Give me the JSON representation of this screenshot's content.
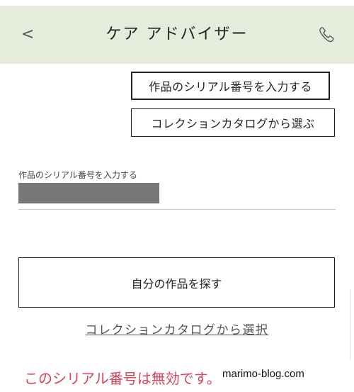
{
  "header": {
    "title": "ケア アドバイザー",
    "back_icon": "chevron-left-icon",
    "back_glyph": "<",
    "phone_icon": "phone-icon",
    "background": "#e6ecdb"
  },
  "options": {
    "serial_label": "作品のシリアル番号を入力する",
    "catalog_label": "コレクションカタログから選ぶ"
  },
  "serial_field": {
    "label": "作品のシリアル番号を入力する",
    "value_redacted": true
  },
  "search_button": {
    "label": "自分の作品を探す"
  },
  "catalog_link": {
    "label": "コレクションカタログから選択"
  },
  "error": {
    "message": "このシリアル番号は無効です。",
    "color": "#d8425a"
  },
  "watermark": {
    "text": "marimo-blog.com"
  }
}
